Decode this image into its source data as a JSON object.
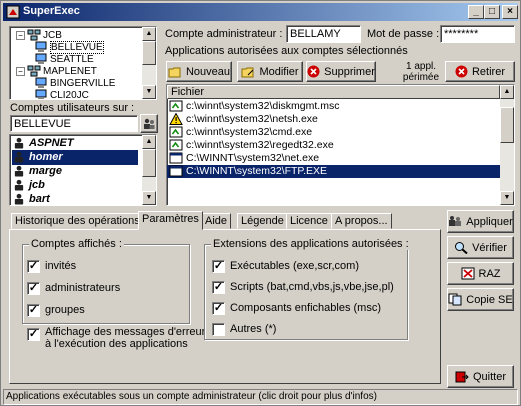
{
  "window": {
    "title": "SuperExec"
  },
  "tree": [
    {
      "label": "JCB",
      "type": "group",
      "indent": 0
    },
    {
      "label": "BELLEVUE",
      "type": "computer",
      "indent": 1,
      "selected": true
    },
    {
      "label": "SEATTLE",
      "type": "computer",
      "indent": 1
    },
    {
      "label": "MAPLENET",
      "type": "group",
      "indent": 0
    },
    {
      "label": "BINGERVILLE",
      "type": "computer",
      "indent": 1
    },
    {
      "label": "CLI20JC",
      "type": "computer",
      "indent": 1
    }
  ],
  "users_section": {
    "label": "Comptes utilisateurs sur :",
    "machine": "BELLEVUE",
    "users": [
      {
        "name": "ASPNET",
        "selected": false
      },
      {
        "name": "homer",
        "selected": true
      },
      {
        "name": "marge",
        "selected": false
      },
      {
        "name": "jcb",
        "selected": false
      },
      {
        "name": "bart",
        "selected": false
      }
    ]
  },
  "admin": {
    "account_label": "Compte administrateur :",
    "account_value": "BELLAMY",
    "password_label": "Mot de passe :",
    "password_value": "********"
  },
  "apps": {
    "heading": "Applications autorisées aux comptes sélectionnés",
    "expired_note_1": "1 appl.",
    "expired_note_2": "périmée",
    "buttons": {
      "new": "Nouveau",
      "edit": "Modifier",
      "delete": "Supprimer",
      "remove": "Retirer"
    },
    "column_header": "Fichier",
    "files": [
      {
        "path": "c:\\winnt\\system32\\diskmgmt.msc",
        "icon": "msc",
        "selected": false
      },
      {
        "path": "c:\\winnt\\system32\\netsh.exe",
        "icon": "warning",
        "selected": false
      },
      {
        "path": "c:\\winnt\\system32\\cmd.exe",
        "icon": "msc",
        "selected": false
      },
      {
        "path": "c:\\winnt\\system32\\regedt32.exe",
        "icon": "msc",
        "selected": false
      },
      {
        "path": "C:\\WINNT\\system32\\net.exe",
        "icon": "exe",
        "selected": false
      },
      {
        "path": "C:\\WINNT\\system32\\FTP.EXE",
        "icon": "exe",
        "selected": true
      }
    ]
  },
  "tabs": [
    {
      "label": "Historique des opérations",
      "active": false
    },
    {
      "label": "Paramètres",
      "active": true
    },
    {
      "label": "Aide",
      "active": false
    },
    {
      "label": "Légende",
      "active": false
    },
    {
      "label": "Licence",
      "active": false
    },
    {
      "label": "A propos...",
      "active": false
    }
  ],
  "params": {
    "shown_accounts": {
      "title": "Comptes affichés :",
      "items": [
        {
          "label": "invités",
          "checked": true
        },
        {
          "label": "administrateurs",
          "checked": true
        },
        {
          "label": "groupes",
          "checked": true
        }
      ]
    },
    "error_msg": {
      "line1": "Affichage des messages d'erreur",
      "line2": "à l'exécution des applications",
      "checked": true
    },
    "extensions": {
      "title": "Extensions des applications autorisées :",
      "items": [
        {
          "label": "Exécutables (exe,scr,com)",
          "checked": true
        },
        {
          "label": "Scripts (bat,cmd,vbs,js,vbe,jse,pl)",
          "checked": true
        },
        {
          "label": "Composants enfichables (msc)",
          "checked": true
        },
        {
          "label": "Autres (*)",
          "checked": false
        }
      ]
    }
  },
  "side_buttons": {
    "apply": "Appliquer",
    "verify": "Vérifier",
    "reset": "RAZ",
    "copy": "Copie SE",
    "quit": "Quitter"
  },
  "status": "Applications exécutables sous un compte administrateur (clic droit pour plus d'infos)",
  "colors": {
    "selection": "#0a246a",
    "face": "#d4d0c8",
    "delete_red": "#cc0000"
  }
}
